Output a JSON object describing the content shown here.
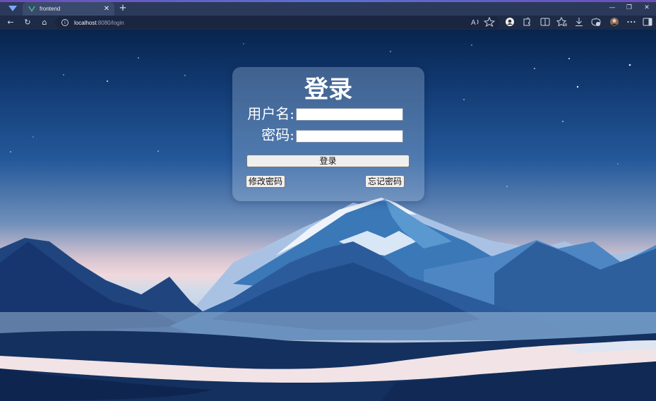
{
  "browser": {
    "tab": {
      "title": "frontend",
      "close_glyph": "✕"
    },
    "new_tab_glyph": "+",
    "window_controls": {
      "minimize": "—",
      "restore": "❐",
      "close": "✕"
    },
    "nav": {
      "back": "←",
      "reload": "↻",
      "home": "⌂"
    },
    "address": {
      "host": "localhost",
      "path": ":8080/login"
    },
    "toolbar_icons": [
      "read-aloud-icon",
      "favorite-icon",
      "profile-icon",
      "extensions-icon",
      "split-screen-icon",
      "favorites-icon",
      "downloads-icon",
      "browser-essentials-icon",
      "avatar",
      "more-icon",
      "sidebar-icon"
    ]
  },
  "login": {
    "title": "登录",
    "username_label": "用户名:",
    "password_label": "密码:",
    "username_value": "",
    "password_value": "",
    "submit_label": "登录",
    "change_password_label": "修改密码",
    "forgot_password_label": "忘记密码"
  }
}
